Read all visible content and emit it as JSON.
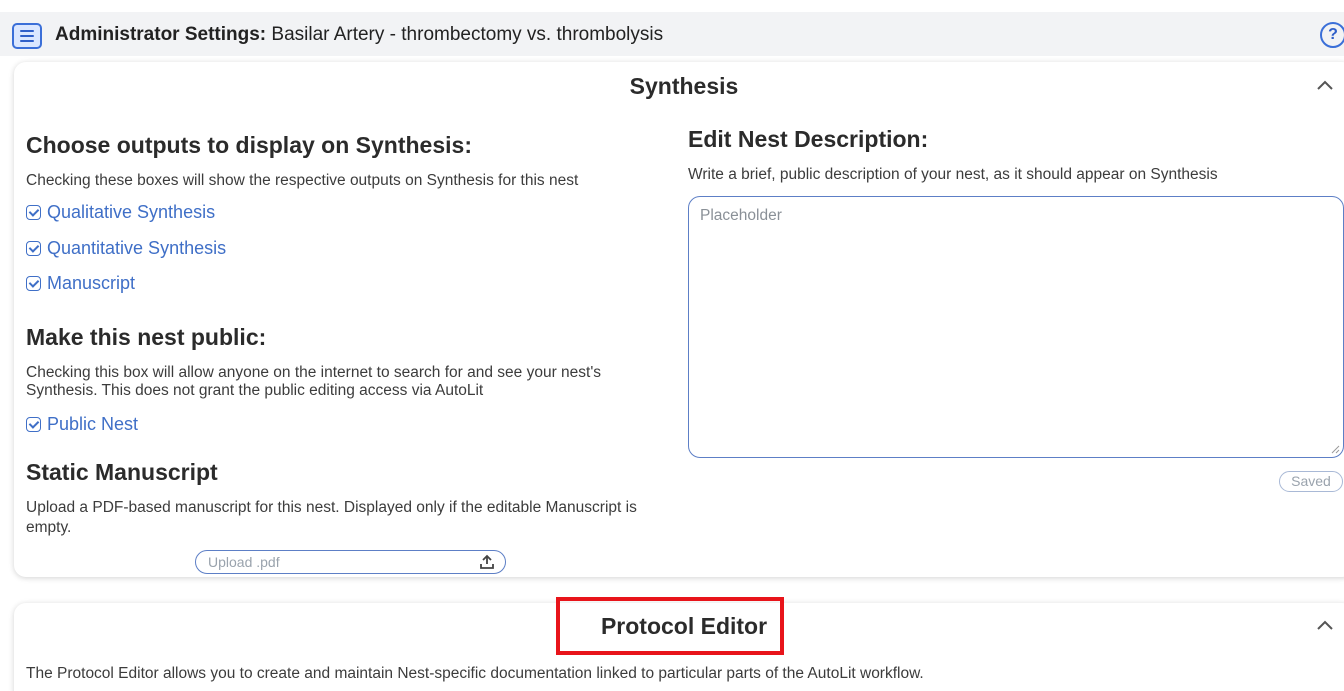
{
  "header": {
    "title_bold": "Administrator Settings:",
    "title_rest": " Basilar Artery - thrombectomy vs. thrombolysis",
    "help_glyph": "?",
    "menu_icon": "menu-icon",
    "help_icon": "help-icon"
  },
  "synthesis": {
    "title": "Synthesis",
    "outputs": {
      "heading": "Choose outputs to display on Synthesis:",
      "description": "Checking these boxes will show the respective outputs on Synthesis for this nest",
      "options": [
        {
          "label": "Qualitative Synthesis",
          "checked": true
        },
        {
          "label": "Quantitative Synthesis",
          "checked": true
        },
        {
          "label": "Manuscript",
          "checked": true
        }
      ]
    },
    "public": {
      "heading": "Make this nest public:",
      "description_line1": "Checking this box will allow anyone on the internet to search for and see your nest's",
      "description_line2": "Synthesis. This does not grant the public editing access via AutoLit",
      "option_label": "Public Nest",
      "checked": true
    },
    "static_manuscript": {
      "heading": "Static Manuscript",
      "description_line1": "Upload a PDF-based manuscript for this nest. Displayed only if the editable Manuscript is",
      "description_line2": "empty.",
      "upload_placeholder": "Upload .pdf"
    },
    "nest_description": {
      "heading": "Edit Nest Description:",
      "description": "Write a brief, public description of your nest, as it should appear on Synthesis",
      "placeholder": "Placeholder",
      "saved_label": "Saved"
    }
  },
  "protocol_editor": {
    "title": "Protocol Editor",
    "description": "The Protocol Editor allows you to create and maintain Nest-specific documentation linked to particular parts of the AutoLit workflow.",
    "highlight_color": "#e8141a"
  },
  "colors": {
    "accent": "#3f6fc7",
    "topbar_bg": "#f2f3f5"
  }
}
